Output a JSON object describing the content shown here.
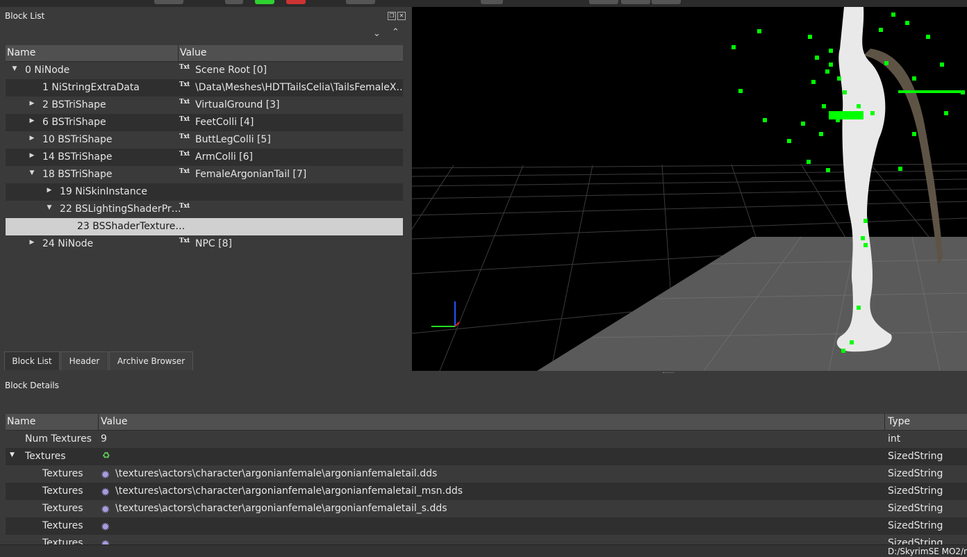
{
  "block_list": {
    "title": "Block List",
    "columns": {
      "name": "Name",
      "value": "Value"
    },
    "rows": [
      {
        "name": "0 NiNode",
        "value": "Scene Root [0]",
        "expander": "expanded",
        "indent": 0,
        "txt": "Txt"
      },
      {
        "name": "1 NiStringExtraData",
        "value": "\\Data\\Meshes\\HDTTailsCelia\\TailsFemaleX…",
        "expander": "none",
        "indent": 1,
        "txt": "Txt"
      },
      {
        "name": "2 BSTriShape",
        "value": "VirtualGround [3]",
        "expander": "collapsed",
        "indent": 1,
        "txt": "Txt"
      },
      {
        "name": "6 BSTriShape",
        "value": "FeetColli [4]",
        "expander": "collapsed",
        "indent": 1,
        "txt": "Txt"
      },
      {
        "name": "10 BSTriShape",
        "value": "ButtLegColli [5]",
        "expander": "collapsed",
        "indent": 1,
        "txt": "Txt"
      },
      {
        "name": "14 BSTriShape",
        "value": "ArmColli [6]",
        "expander": "collapsed",
        "indent": 1,
        "txt": "Txt"
      },
      {
        "name": "18 BSTriShape",
        "value": "FemaleArgonianTail [7]",
        "expander": "expanded",
        "indent": 1,
        "txt": "Txt"
      },
      {
        "name": "19 NiSkinInstance",
        "value": "",
        "expander": "collapsed",
        "indent": 2,
        "txt": ""
      },
      {
        "name": "22 BSLightingShaderPr…",
        "value": "",
        "expander": "expanded",
        "indent": 2,
        "txt": "Txt"
      },
      {
        "name": "23 BSShaderTexture…",
        "value": "",
        "expander": "none",
        "indent": 3,
        "txt": "",
        "selected": true
      },
      {
        "name": "24 NiNode",
        "value": "NPC [8]",
        "expander": "collapsed",
        "indent": 1,
        "txt": "Txt"
      }
    ],
    "tabs": [
      "Block List",
      "Header",
      "Archive Browser"
    ]
  },
  "block_details": {
    "title": "Block Details",
    "columns": {
      "name": "Name",
      "value": "Value",
      "type": "Type"
    },
    "rows": [
      {
        "name": "Num Textures",
        "value": "9",
        "type": "int",
        "icon": "",
        "expander": "none",
        "indent": 1
      },
      {
        "name": "Textures",
        "value": "",
        "type": "SizedString",
        "icon": "cycle",
        "expander": "expanded",
        "indent": 1
      },
      {
        "name": "Textures",
        "value": "\\textures\\actors\\character\\argonianfemale\\argonianfemaletail.dds",
        "type": "SizedString",
        "icon": "gear",
        "expander": "none",
        "indent": 2
      },
      {
        "name": "Textures",
        "value": "\\textures\\actors\\character\\argonianfemale\\argonianfemaletail_msn.dds",
        "type": "SizedString",
        "icon": "gear",
        "expander": "none",
        "indent": 2
      },
      {
        "name": "Textures",
        "value": "\\textures\\actors\\character\\argonianfemale\\argonianfemaletail_s.dds",
        "type": "SizedString",
        "icon": "gear",
        "expander": "none",
        "indent": 2
      },
      {
        "name": "Textures",
        "value": "",
        "type": "SizedString",
        "icon": "gear",
        "expander": "none",
        "indent": 2
      },
      {
        "name": "Textures",
        "value": "",
        "type": "SizedString",
        "icon": "gear",
        "expander": "none",
        "indent": 2
      }
    ]
  },
  "status_bar": {
    "path": "D:/SkyrimSE MO2/r"
  },
  "icons": {
    "expanded": "tree-expanded-icon",
    "collapsed": "tree-collapsed-icon",
    "gear": "gear-icon",
    "cycle": "cycle-icon"
  },
  "colors": {
    "selection": "#d0d0d0",
    "bone_marker": "#00ff00",
    "grid_floor": "#555555"
  }
}
